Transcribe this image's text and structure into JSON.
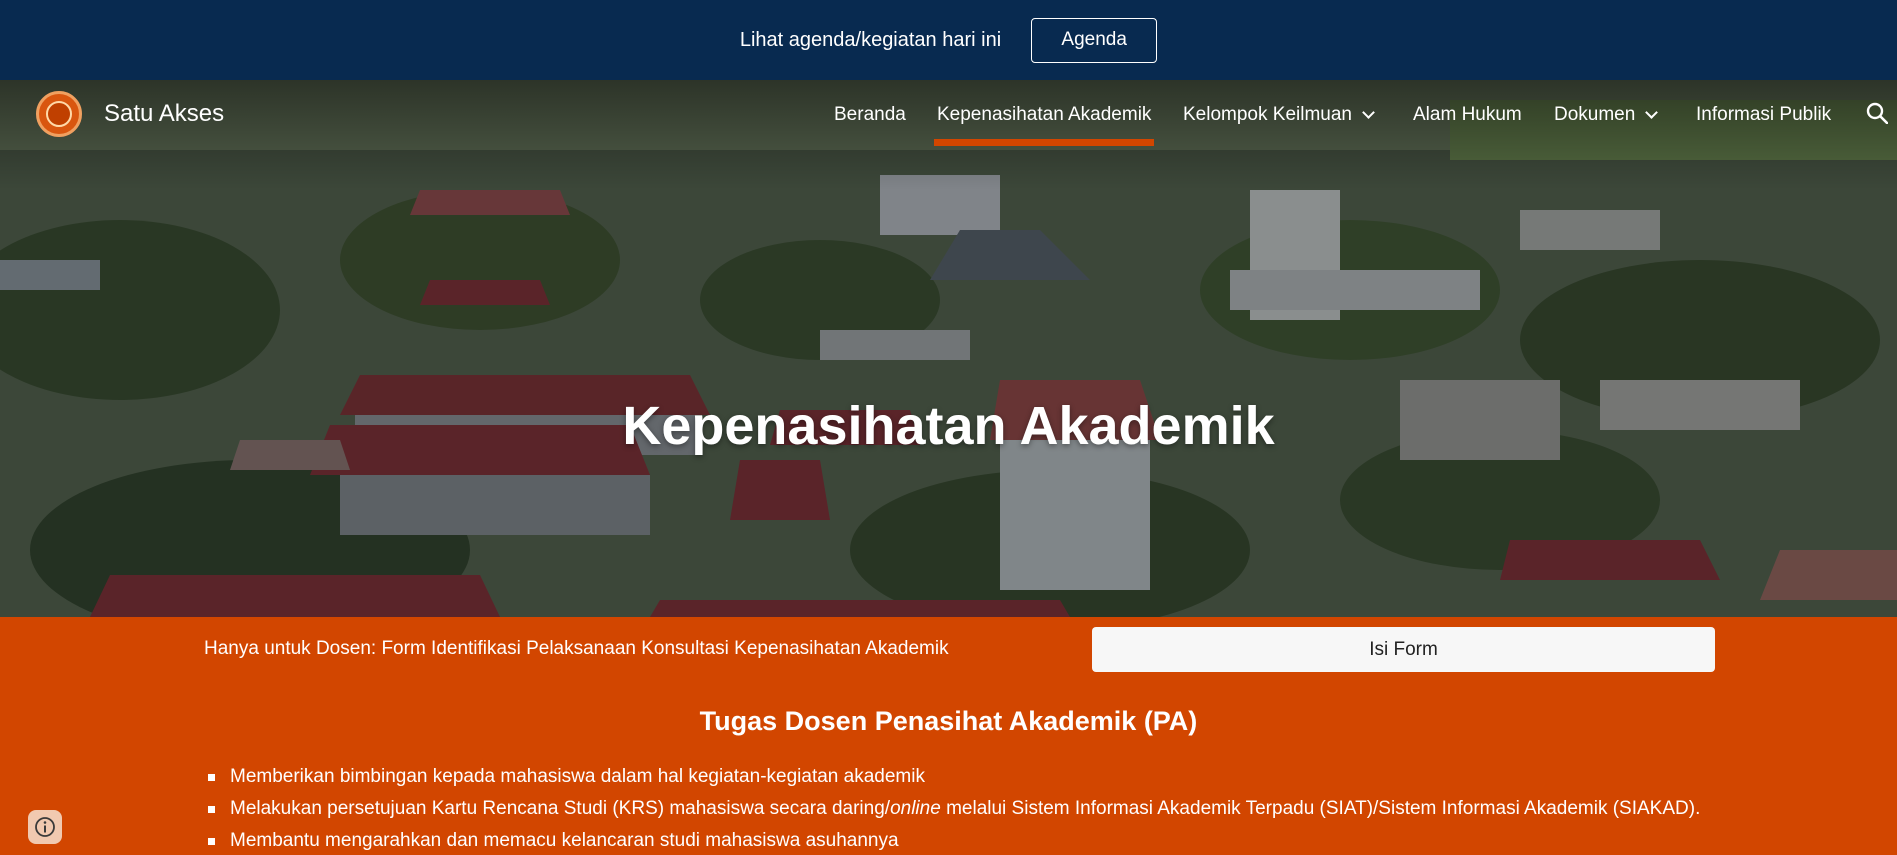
{
  "announcement": {
    "text": "Lihat agenda/kegiatan hari ini",
    "button_label": "Agenda"
  },
  "site": {
    "name": "Satu Akses"
  },
  "nav": {
    "items": [
      {
        "label": "Beranda",
        "active": false,
        "has_dropdown": false
      },
      {
        "label": "Kepenasihatan Akademik",
        "active": true,
        "has_dropdown": false
      },
      {
        "label": "Kelompok Keilmuan",
        "active": false,
        "has_dropdown": true
      },
      {
        "label": "Alam Hukum",
        "active": false,
        "has_dropdown": false
      },
      {
        "label": "Dokumen",
        "active": false,
        "has_dropdown": true
      },
      {
        "label": "Informasi Publik",
        "active": false,
        "has_dropdown": false
      }
    ],
    "search_icon": "search-icon"
  },
  "hero": {
    "title": "Kepenasihatan Akademik"
  },
  "form_row": {
    "text": "Hanya untuk Dosen: Form Identifikasi Pelaksanaan Konsultasi Kepenasihatan Akademik",
    "button_label": "Isi Form"
  },
  "duties": {
    "title": "Tugas Dosen Penasihat Akademik (PA)",
    "items": [
      {
        "text": "Memberikan bimbingan kepada mahasiswa dalam hal kegiatan-kegiatan akademik"
      },
      {
        "before": "Melakukan persetujuan Kartu Rencana Studi (KRS) mahasiswa secara daring/",
        "italic": "online",
        "after": " melalui Sistem Informasi Akademik Terpadu (SIAT)/Sistem Informasi Akademik (SIAKAD)."
      },
      {
        "text": "Membantu mengarahkan dan memacu kelancaran studi mahasiswa asuhannya"
      }
    ]
  },
  "colors": {
    "announcement_bg": "#082a50",
    "accent_orange": "#d24600",
    "button_bg": "#f7f7f7"
  }
}
